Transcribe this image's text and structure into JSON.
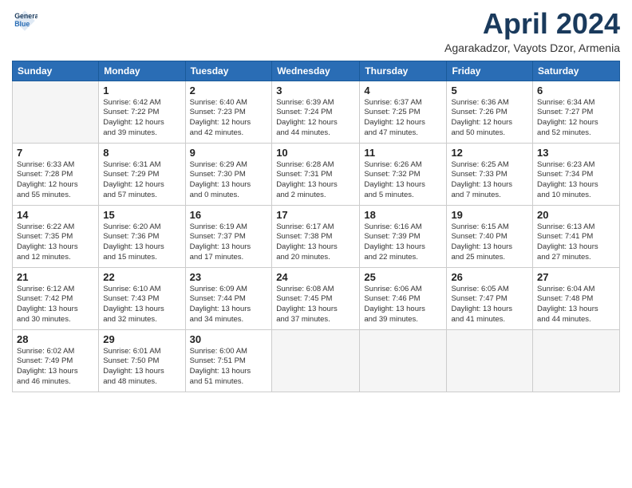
{
  "logo": {
    "line1": "General",
    "line2": "Blue"
  },
  "title": "April 2024",
  "location": "Agarakadzor, Vayots Dzor, Armenia",
  "days": [
    "Sunday",
    "Monday",
    "Tuesday",
    "Wednesday",
    "Thursday",
    "Friday",
    "Saturday"
  ],
  "cells": [
    {
      "day": null
    },
    {
      "day": "1",
      "sunrise": "Sunrise: 6:42 AM",
      "sunset": "Sunset: 7:22 PM",
      "daylight": "Daylight: 12 hours",
      "daylight2": "and 39 minutes."
    },
    {
      "day": "2",
      "sunrise": "Sunrise: 6:40 AM",
      "sunset": "Sunset: 7:23 PM",
      "daylight": "Daylight: 12 hours",
      "daylight2": "and 42 minutes."
    },
    {
      "day": "3",
      "sunrise": "Sunrise: 6:39 AM",
      "sunset": "Sunset: 7:24 PM",
      "daylight": "Daylight: 12 hours",
      "daylight2": "and 44 minutes."
    },
    {
      "day": "4",
      "sunrise": "Sunrise: 6:37 AM",
      "sunset": "Sunset: 7:25 PM",
      "daylight": "Daylight: 12 hours",
      "daylight2": "and 47 minutes."
    },
    {
      "day": "5",
      "sunrise": "Sunrise: 6:36 AM",
      "sunset": "Sunset: 7:26 PM",
      "daylight": "Daylight: 12 hours",
      "daylight2": "and 50 minutes."
    },
    {
      "day": "6",
      "sunrise": "Sunrise: 6:34 AM",
      "sunset": "Sunset: 7:27 PM",
      "daylight": "Daylight: 12 hours",
      "daylight2": "and 52 minutes."
    },
    {
      "day": "7",
      "sunrise": "Sunrise: 6:33 AM",
      "sunset": "Sunset: 7:28 PM",
      "daylight": "Daylight: 12 hours",
      "daylight2": "and 55 minutes."
    },
    {
      "day": "8",
      "sunrise": "Sunrise: 6:31 AM",
      "sunset": "Sunset: 7:29 PM",
      "daylight": "Daylight: 12 hours",
      "daylight2": "and 57 minutes."
    },
    {
      "day": "9",
      "sunrise": "Sunrise: 6:29 AM",
      "sunset": "Sunset: 7:30 PM",
      "daylight": "Daylight: 13 hours",
      "daylight2": "and 0 minutes."
    },
    {
      "day": "10",
      "sunrise": "Sunrise: 6:28 AM",
      "sunset": "Sunset: 7:31 PM",
      "daylight": "Daylight: 13 hours",
      "daylight2": "and 2 minutes."
    },
    {
      "day": "11",
      "sunrise": "Sunrise: 6:26 AM",
      "sunset": "Sunset: 7:32 PM",
      "daylight": "Daylight: 13 hours",
      "daylight2": "and 5 minutes."
    },
    {
      "day": "12",
      "sunrise": "Sunrise: 6:25 AM",
      "sunset": "Sunset: 7:33 PM",
      "daylight": "Daylight: 13 hours",
      "daylight2": "and 7 minutes."
    },
    {
      "day": "13",
      "sunrise": "Sunrise: 6:23 AM",
      "sunset": "Sunset: 7:34 PM",
      "daylight": "Daylight: 13 hours",
      "daylight2": "and 10 minutes."
    },
    {
      "day": "14",
      "sunrise": "Sunrise: 6:22 AM",
      "sunset": "Sunset: 7:35 PM",
      "daylight": "Daylight: 13 hours",
      "daylight2": "and 12 minutes."
    },
    {
      "day": "15",
      "sunrise": "Sunrise: 6:20 AM",
      "sunset": "Sunset: 7:36 PM",
      "daylight": "Daylight: 13 hours",
      "daylight2": "and 15 minutes."
    },
    {
      "day": "16",
      "sunrise": "Sunrise: 6:19 AM",
      "sunset": "Sunset: 7:37 PM",
      "daylight": "Daylight: 13 hours",
      "daylight2": "and 17 minutes."
    },
    {
      "day": "17",
      "sunrise": "Sunrise: 6:17 AM",
      "sunset": "Sunset: 7:38 PM",
      "daylight": "Daylight: 13 hours",
      "daylight2": "and 20 minutes."
    },
    {
      "day": "18",
      "sunrise": "Sunrise: 6:16 AM",
      "sunset": "Sunset: 7:39 PM",
      "daylight": "Daylight: 13 hours",
      "daylight2": "and 22 minutes."
    },
    {
      "day": "19",
      "sunrise": "Sunrise: 6:15 AM",
      "sunset": "Sunset: 7:40 PM",
      "daylight": "Daylight: 13 hours",
      "daylight2": "and 25 minutes."
    },
    {
      "day": "20",
      "sunrise": "Sunrise: 6:13 AM",
      "sunset": "Sunset: 7:41 PM",
      "daylight": "Daylight: 13 hours",
      "daylight2": "and 27 minutes."
    },
    {
      "day": "21",
      "sunrise": "Sunrise: 6:12 AM",
      "sunset": "Sunset: 7:42 PM",
      "daylight": "Daylight: 13 hours",
      "daylight2": "and 30 minutes."
    },
    {
      "day": "22",
      "sunrise": "Sunrise: 6:10 AM",
      "sunset": "Sunset: 7:43 PM",
      "daylight": "Daylight: 13 hours",
      "daylight2": "and 32 minutes."
    },
    {
      "day": "23",
      "sunrise": "Sunrise: 6:09 AM",
      "sunset": "Sunset: 7:44 PM",
      "daylight": "Daylight: 13 hours",
      "daylight2": "and 34 minutes."
    },
    {
      "day": "24",
      "sunrise": "Sunrise: 6:08 AM",
      "sunset": "Sunset: 7:45 PM",
      "daylight": "Daylight: 13 hours",
      "daylight2": "and 37 minutes."
    },
    {
      "day": "25",
      "sunrise": "Sunrise: 6:06 AM",
      "sunset": "Sunset: 7:46 PM",
      "daylight": "Daylight: 13 hours",
      "daylight2": "and 39 minutes."
    },
    {
      "day": "26",
      "sunrise": "Sunrise: 6:05 AM",
      "sunset": "Sunset: 7:47 PM",
      "daylight": "Daylight: 13 hours",
      "daylight2": "and 41 minutes."
    },
    {
      "day": "27",
      "sunrise": "Sunrise: 6:04 AM",
      "sunset": "Sunset: 7:48 PM",
      "daylight": "Daylight: 13 hours",
      "daylight2": "and 44 minutes."
    },
    {
      "day": "28",
      "sunrise": "Sunrise: 6:02 AM",
      "sunset": "Sunset: 7:49 PM",
      "daylight": "Daylight: 13 hours",
      "daylight2": "and 46 minutes."
    },
    {
      "day": "29",
      "sunrise": "Sunrise: 6:01 AM",
      "sunset": "Sunset: 7:50 PM",
      "daylight": "Daylight: 13 hours",
      "daylight2": "and 48 minutes."
    },
    {
      "day": "30",
      "sunrise": "Sunrise: 6:00 AM",
      "sunset": "Sunset: 7:51 PM",
      "daylight": "Daylight: 13 hours",
      "daylight2": "and 51 minutes."
    },
    {
      "day": null
    },
    {
      "day": null
    },
    {
      "day": null
    },
    {
      "day": null
    }
  ]
}
